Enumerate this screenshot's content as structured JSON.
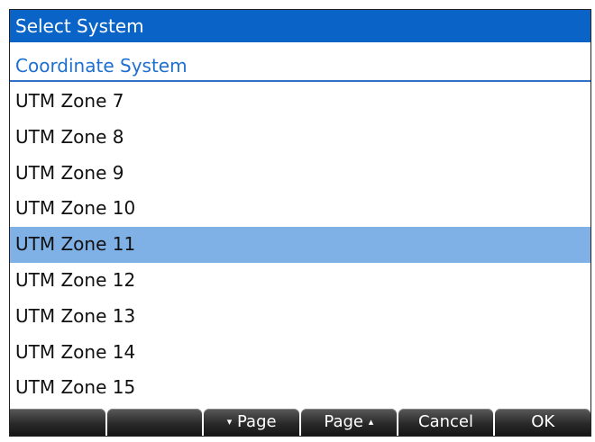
{
  "dialog": {
    "title": "Select System"
  },
  "section": {
    "label": "Coordinate System"
  },
  "items": [
    {
      "label": "UTM Zone 7"
    },
    {
      "label": "UTM Zone 8"
    },
    {
      "label": "UTM Zone 9"
    },
    {
      "label": "UTM Zone 10"
    },
    {
      "label": "UTM Zone 11",
      "selected": true
    },
    {
      "label": "UTM Zone 12"
    },
    {
      "label": "UTM Zone 13"
    },
    {
      "label": "UTM Zone 14"
    },
    {
      "label": "UTM Zone 15"
    }
  ],
  "softkeys": {
    "k1": "",
    "k2": "",
    "page_down_glyph": "▾",
    "page_down": "Page",
    "page_up": "Page",
    "page_up_glyph": "▴",
    "cancel": "Cancel",
    "ok": "OK"
  },
  "colors": {
    "title_bg": "#0a64c8",
    "selected_bg": "#7fb1e6",
    "section_text": "#1e6fd0"
  }
}
